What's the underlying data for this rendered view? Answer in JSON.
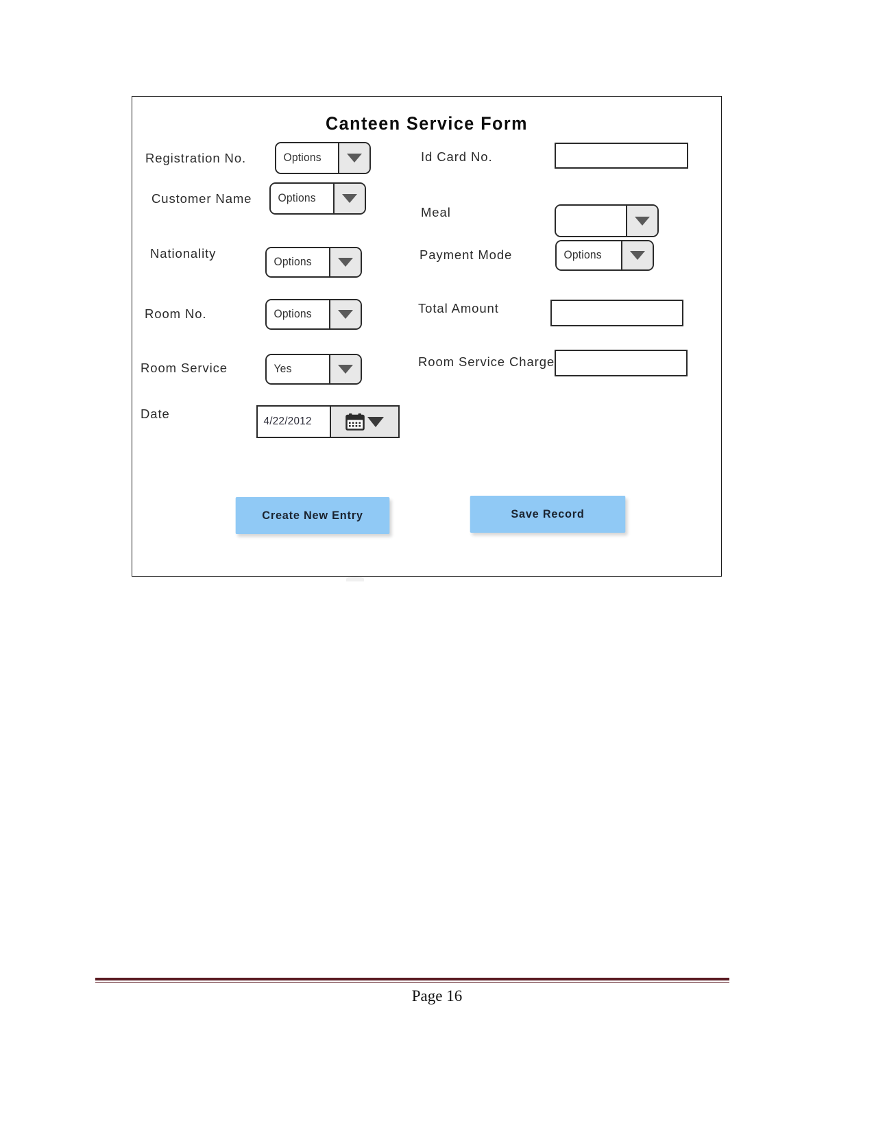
{
  "document": {
    "footer": {
      "page_label": "Page 16",
      "rule_color": "#5a1b22"
    }
  },
  "form": {
    "title": "Canteen Service Form",
    "accent_color": "#90c9f5",
    "left_column": [
      {
        "label": "Registration No.",
        "control": "combo",
        "value": "Options"
      },
      {
        "label": "Customer Name",
        "control": "combo",
        "value": "Options"
      },
      {
        "label": "Nationality",
        "control": "combo",
        "value": "Options"
      },
      {
        "label": "Room No.",
        "control": "combo",
        "value": "Options"
      },
      {
        "label": "Room Service",
        "control": "combo",
        "value": "Yes"
      },
      {
        "label": "Date",
        "control": "datepicker",
        "value": "4/22/2012"
      }
    ],
    "right_column": [
      {
        "label": "Id Card No.",
        "control": "textbox",
        "value": ""
      },
      {
        "label": "Meal",
        "control": "combo",
        "value": ""
      },
      {
        "label": "Payment Mode",
        "control": "combo",
        "value": "Options"
      },
      {
        "label": "Total Amount",
        "control": "textbox",
        "value": ""
      },
      {
        "label": "Room Service Charge",
        "control": "textbox",
        "value": ""
      }
    ],
    "buttons": [
      {
        "label": "Create New Entry"
      },
      {
        "label": "Save Record"
      }
    ]
  }
}
